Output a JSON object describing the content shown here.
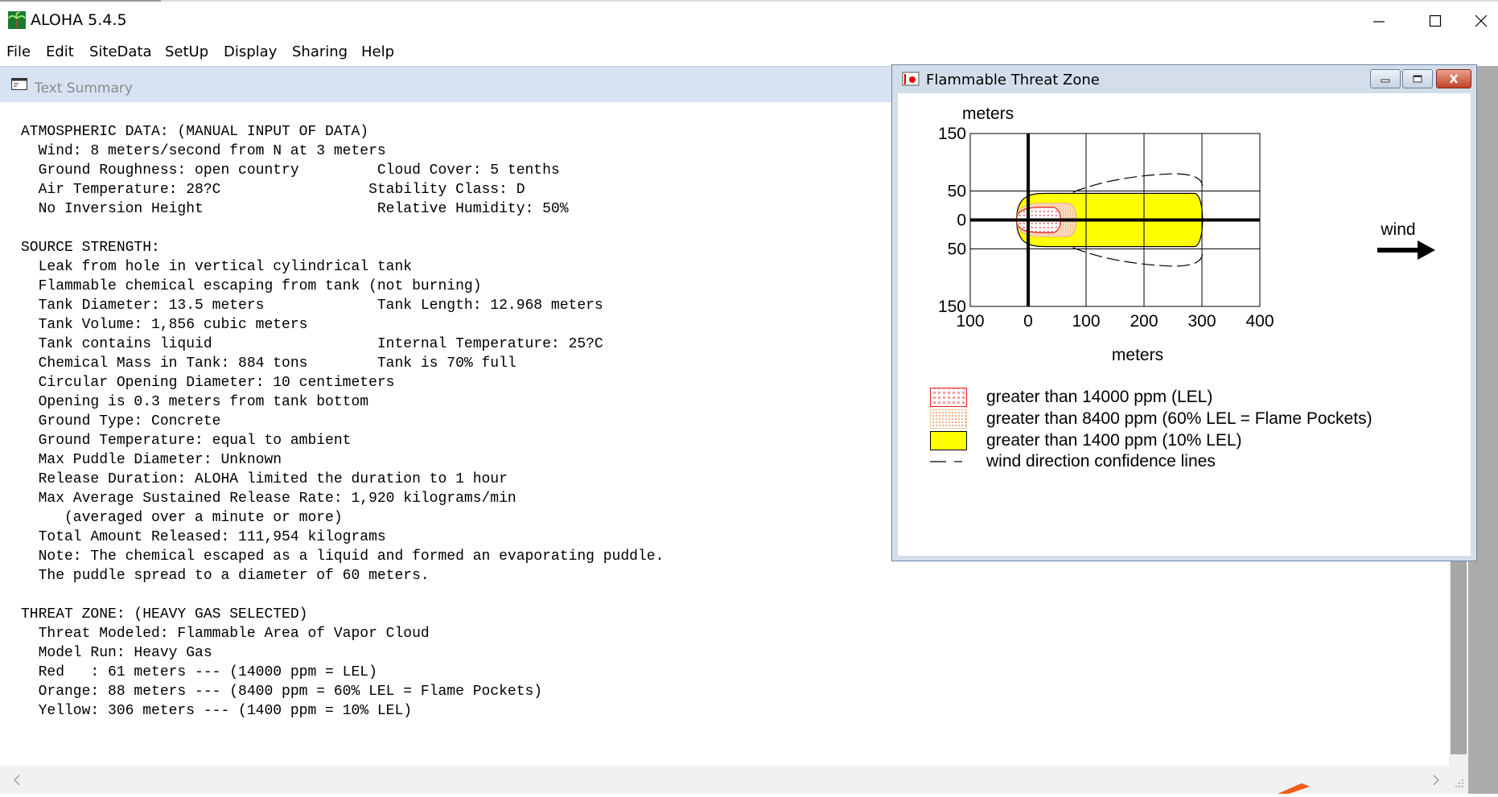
{
  "window": {
    "title": "ALOHA 5.4.5"
  },
  "menu": [
    "File",
    "Edit",
    "SiteData",
    "SetUp",
    "Display",
    "Sharing",
    "Help"
  ],
  "text_summary": {
    "title": "Text Summary",
    "lines": [
      "ATMOSPHERIC DATA: (MANUAL INPUT OF DATA)",
      "  Wind: 8 meters/second from N at 3 meters",
      "  Ground Roughness: open country         Cloud Cover: 5 tenths",
      "  Air Temperature: 28?C                 Stability Class: D",
      "  No Inversion Height                    Relative Humidity: 50%",
      "",
      "SOURCE STRENGTH:",
      "  Leak from hole in vertical cylindrical tank",
      "  Flammable chemical escaping from tank (not burning)",
      "  Tank Diameter: 13.5 meters             Tank Length: 12.968 meters",
      "  Tank Volume: 1,856 cubic meters",
      "  Tank contains liquid                   Internal Temperature: 25?C",
      "  Chemical Mass in Tank: 884 tons        Tank is 70% full",
      "  Circular Opening Diameter: 10 centimeters",
      "  Opening is 0.3 meters from tank bottom",
      "  Ground Type: Concrete",
      "  Ground Temperature: equal to ambient",
      "  Max Puddle Diameter: Unknown",
      "  Release Duration: ALOHA limited the duration to 1 hour",
      "  Max Average Sustained Release Rate: 1,920 kilograms/min",
      "     (averaged over a minute or more)",
      "  Total Amount Released: 111,954 kilograms",
      "  Note: The chemical escaped as a liquid and formed an evaporating puddle.",
      "  The puddle spread to a diameter of 60 meters.",
      "",
      "THREAT ZONE: (HEAVY GAS SELECTED)",
      "  Threat Modeled: Flammable Area of Vapor Cloud",
      "  Model Run: Heavy Gas",
      "  Red   : 61 meters --- (14000 ppm = LEL)",
      "  Orange: 88 meters --- (8400 ppm = 60% LEL = Flame Pockets)",
      "  Yellow: 306 meters --- (1400 ppm = 10% LEL)"
    ]
  },
  "threat_zone": {
    "title": "Flammable Threat Zone",
    "wind_label": "wind",
    "legend": [
      {
        "label": "greater than 14000 ppm (LEL)",
        "color": "#ff3333"
      },
      {
        "label": "greater than 8400 ppm (60% LEL = Flame Pockets)",
        "color": "#f4b183"
      },
      {
        "label": "greater than 1400 ppm (10% LEL)",
        "color": "#ffff00"
      },
      {
        "label": "wind direction confidence lines",
        "color": "#000000"
      }
    ]
  },
  "chart_data": {
    "type": "area",
    "xlabel": "meters",
    "ylabel": "meters",
    "x_ticks": [
      "100",
      "0",
      "100",
      "200",
      "300",
      "400"
    ],
    "y_ticks": [
      "150",
      "50",
      "0",
      "50",
      "150"
    ],
    "xlim": [
      -100,
      400
    ],
    "ylim": [
      -150,
      150
    ],
    "grid": true,
    "series": [
      {
        "name": "greater than 1400 ppm (10% LEL)",
        "extent_downwind": 306,
        "color": "#ffff00"
      },
      {
        "name": "greater than 8400 ppm (60% LEL = Flame Pockets)",
        "extent_downwind": 88,
        "color": "#f4b183"
      },
      {
        "name": "greater than 14000 ppm (LEL)",
        "extent_downwind": 61,
        "color": "#ff3333"
      }
    ]
  },
  "colors": {
    "ts_titlebar": "#d7e3f3",
    "mdi_background": "#ababab",
    "yellow_zone": "#ffff00"
  }
}
